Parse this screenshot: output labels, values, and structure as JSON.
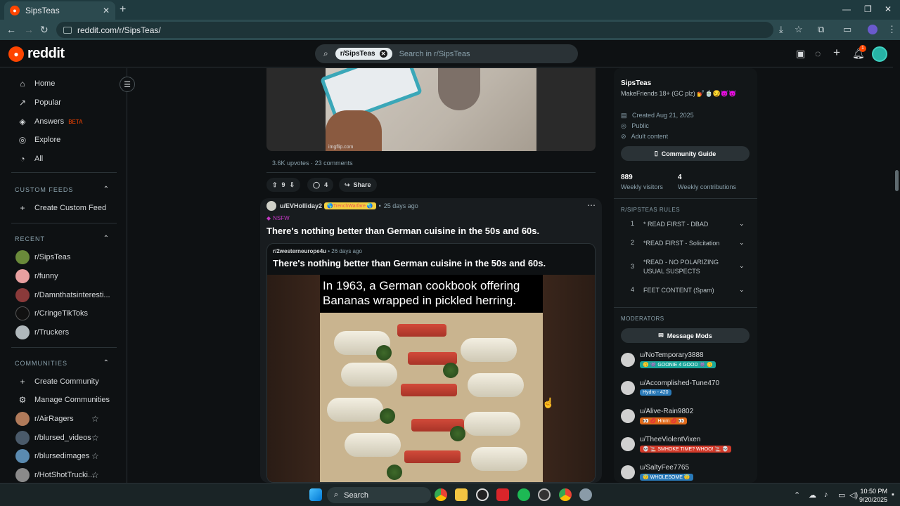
{
  "browser": {
    "tab_title": "SipsTeas",
    "url": "reddit.com/r/SipsTeas/"
  },
  "header": {
    "logo_text": "reddit",
    "search_chip": "r/SipsTeas",
    "search_placeholder": "Search in r/SipsTeas",
    "notif_count": "1"
  },
  "sidebar": {
    "nav": [
      {
        "label": "Home",
        "icon": "home-icon"
      },
      {
        "label": "Popular",
        "icon": "popular-icon"
      },
      {
        "label": "Answers",
        "icon": "answers-icon",
        "badge": "BETA"
      },
      {
        "label": "Explore",
        "icon": "explore-icon"
      },
      {
        "label": "All",
        "icon": "all-icon"
      }
    ],
    "custom_feeds_title": "CUSTOM FEEDS",
    "create_custom_feed": "Create Custom Feed",
    "recent_title": "RECENT",
    "recent": [
      {
        "label": "r/SipsTeas",
        "color": "#6a8a3a"
      },
      {
        "label": "r/funny",
        "color": "#e8a0a0"
      },
      {
        "label": "r/Damnthatsinteresti...",
        "color": "#8a3a3a"
      },
      {
        "label": "r/CringeTikToks",
        "color": "#111111"
      },
      {
        "label": "r/Truckers",
        "color": "#b0b8bc"
      }
    ],
    "communities_title": "COMMUNITIES",
    "create_community": "Create Community",
    "manage_communities": "Manage Communities",
    "communities": [
      {
        "label": "r/AirRagers",
        "color": "#b07a5a"
      },
      {
        "label": "r/blursed_videos",
        "color": "#4a5a6a"
      },
      {
        "label": "r/blursedimages",
        "color": "#5a8ab0"
      },
      {
        "label": "r/HotShotTrucki...",
        "color": "#8a8a8a"
      }
    ]
  },
  "post1": {
    "watermark": "imgflip.com",
    "upvotes": "3.6K upvotes",
    "comments": "23 comments",
    "vote_count": "9",
    "comment_count": "4",
    "share_label": "Share"
  },
  "post2": {
    "author": "u/EVHolliday2",
    "flair": "🌎TrenchWarfare 🌏",
    "age": "25 days ago",
    "nsfw": "NSFW",
    "title": "There's nothing better than German cuisine in the 50s and 60s.",
    "crosspost_sub": "r/2westerneurope4u",
    "crosspost_age": "26 days ago",
    "crosspost_title": "There's nothing better than German cuisine in the 50s and 60s.",
    "image_caption": "In 1963, a German cookbook offering Bananas wrapped in pickled herring."
  },
  "community": {
    "name": "SipsTeas",
    "description": "MakeFriends 18+ (GC plz) 💅🍵😏👿😈",
    "created": "Created Aug 21, 2025",
    "visibility": "Public",
    "content": "Adult content",
    "guide_button": "Community Guide",
    "visitors": "889",
    "visitors_label": "Weekly visitors",
    "contributions": "4",
    "contributions_label": "Weekly contributions",
    "rules_title": "R/SIPSTEAS RULES",
    "rules": [
      {
        "num": "1",
        "text": "* READ FIRST - DBAD"
      },
      {
        "num": "2",
        "text": "*READ FIRST - Solicitation"
      },
      {
        "num": "3",
        "text": "*READ - NO POLARIZING USUAL SUSPECTS"
      },
      {
        "num": "4",
        "text": "FEET CONTENT (Spam)"
      }
    ],
    "moderators_title": "MODERATORS",
    "message_mods": "Message Mods",
    "mods": [
      {
        "name": "u/NoTemporary3888",
        "flair": "🙃 👾 GOONIE 4 GOOD 👾 🙃",
        "flair_color": "#1aa69a"
      },
      {
        "name": "u/Accomplished-Tune470",
        "flair": "Hydro - 420",
        "flair_color": "#2a7ab8"
      },
      {
        "name": "u/Alive-Rain9802",
        "flair": "👀 💋 Hmm 💋 👀",
        "flair_color": "#e06a1a"
      },
      {
        "name": "u/TheeViolentVixen",
        "flair": "💀 🚬 SMHOKE TIME? WHOO! 🚬 💀",
        "flair_color": "#d23a2a"
      },
      {
        "name": "u/SaltyFee7765",
        "flair": "😇 WHOLESOME 😇",
        "flair_color": "#2a7ab8"
      }
    ]
  },
  "taskbar": {
    "search_label": "Search",
    "time": "10:50 PM",
    "date": "9/20/2025"
  }
}
